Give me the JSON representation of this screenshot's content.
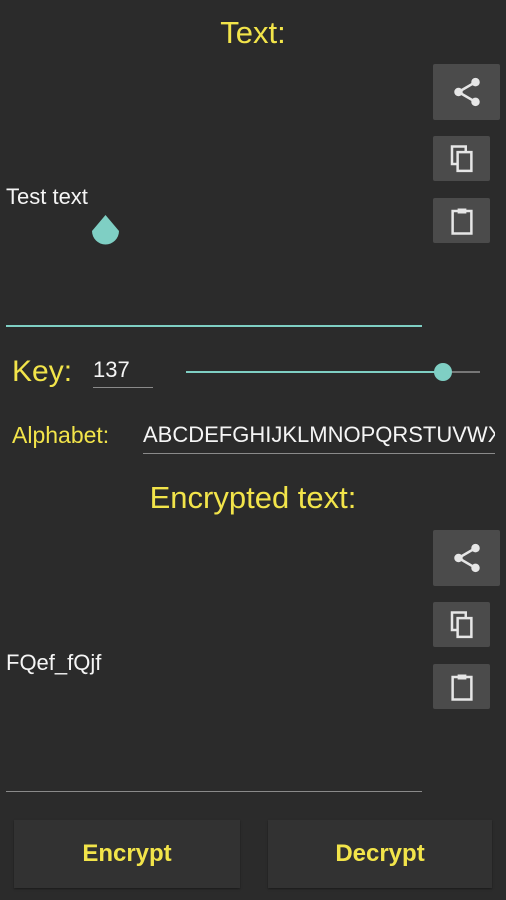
{
  "source": {
    "title": "Text:",
    "value": "Test text"
  },
  "key": {
    "label": "Key:",
    "value": "137",
    "slider_fraction": 0.9
  },
  "alphabet": {
    "label": "Alphabet:",
    "value": "ABCDEFGHIJKLMNOPQRSTUVWXYZabcdefghijklmnopqrstuvwxyz"
  },
  "result": {
    "title": "Encrypted text:",
    "value": "FQef_fQjf"
  },
  "actions": {
    "encrypt_label": "Encrypt",
    "decrypt_label": "Decrypt"
  },
  "icons": {
    "share": "share-icon",
    "copy": "copy-icon",
    "paste": "paste-icon"
  },
  "colors": {
    "background": "#2b2b2b",
    "accent_yellow": "#f2e44a",
    "accent_teal": "#7fcfc4",
    "icon_button": "#4b4b4b"
  }
}
